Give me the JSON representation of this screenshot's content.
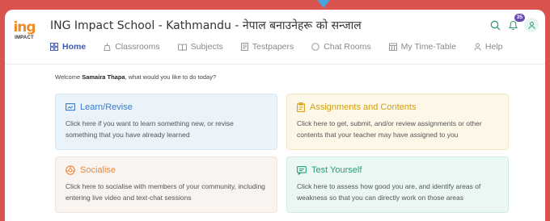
{
  "header": {
    "logo_mark": "ing",
    "logo_word": "IMPACT",
    "title": "ING Impact School - Kathmandu - नेपाल बनाउनेहरू को सन्जाल",
    "notifications_count": "35"
  },
  "nav": [
    {
      "label": "Home",
      "icon": "home-grid-icon",
      "active": true
    },
    {
      "label": "Classrooms",
      "icon": "classroom-icon",
      "active": false
    },
    {
      "label": "Subjects",
      "icon": "book-icon",
      "active": false
    },
    {
      "label": "Testpapers",
      "icon": "testpaper-icon",
      "active": false
    },
    {
      "label": "Chat Rooms",
      "icon": "chat-icon",
      "active": false
    },
    {
      "label": "My Time-Table",
      "icon": "calendar-icon",
      "active": false
    },
    {
      "label": "Help",
      "icon": "help-person-icon",
      "active": false
    }
  ],
  "welcome": {
    "prefix": "Welcome ",
    "name": "Samaira Thapa",
    "suffix": ", what would you like to do today?"
  },
  "cards": [
    {
      "title": "Learn/Revise",
      "description": "Click here if you want to learn something new, or revise something that you have already learned",
      "icon": "presentation-icon"
    },
    {
      "title": "Assignments and Contents",
      "description": "Click here to get, submit, and/or review assignments or other contents that your teacher may have assigned to you",
      "icon": "assignment-icon"
    },
    {
      "title": "Socialise",
      "description": "Click here to socialise with members of your community, including entering live video and text-chat sessions",
      "icon": "socialise-icon"
    },
    {
      "title": "Test Yourself",
      "description": "Click here to assess how good you are, and identify areas of weakness so that you can directly work on those areas",
      "icon": "test-icon"
    }
  ],
  "colors": {
    "accent": "#3b5bb5",
    "background": "#d9534f",
    "learn": "#3d7cc9",
    "assignments": "#d1a011",
    "socialise": "#e8873f",
    "test": "#23a07c"
  }
}
